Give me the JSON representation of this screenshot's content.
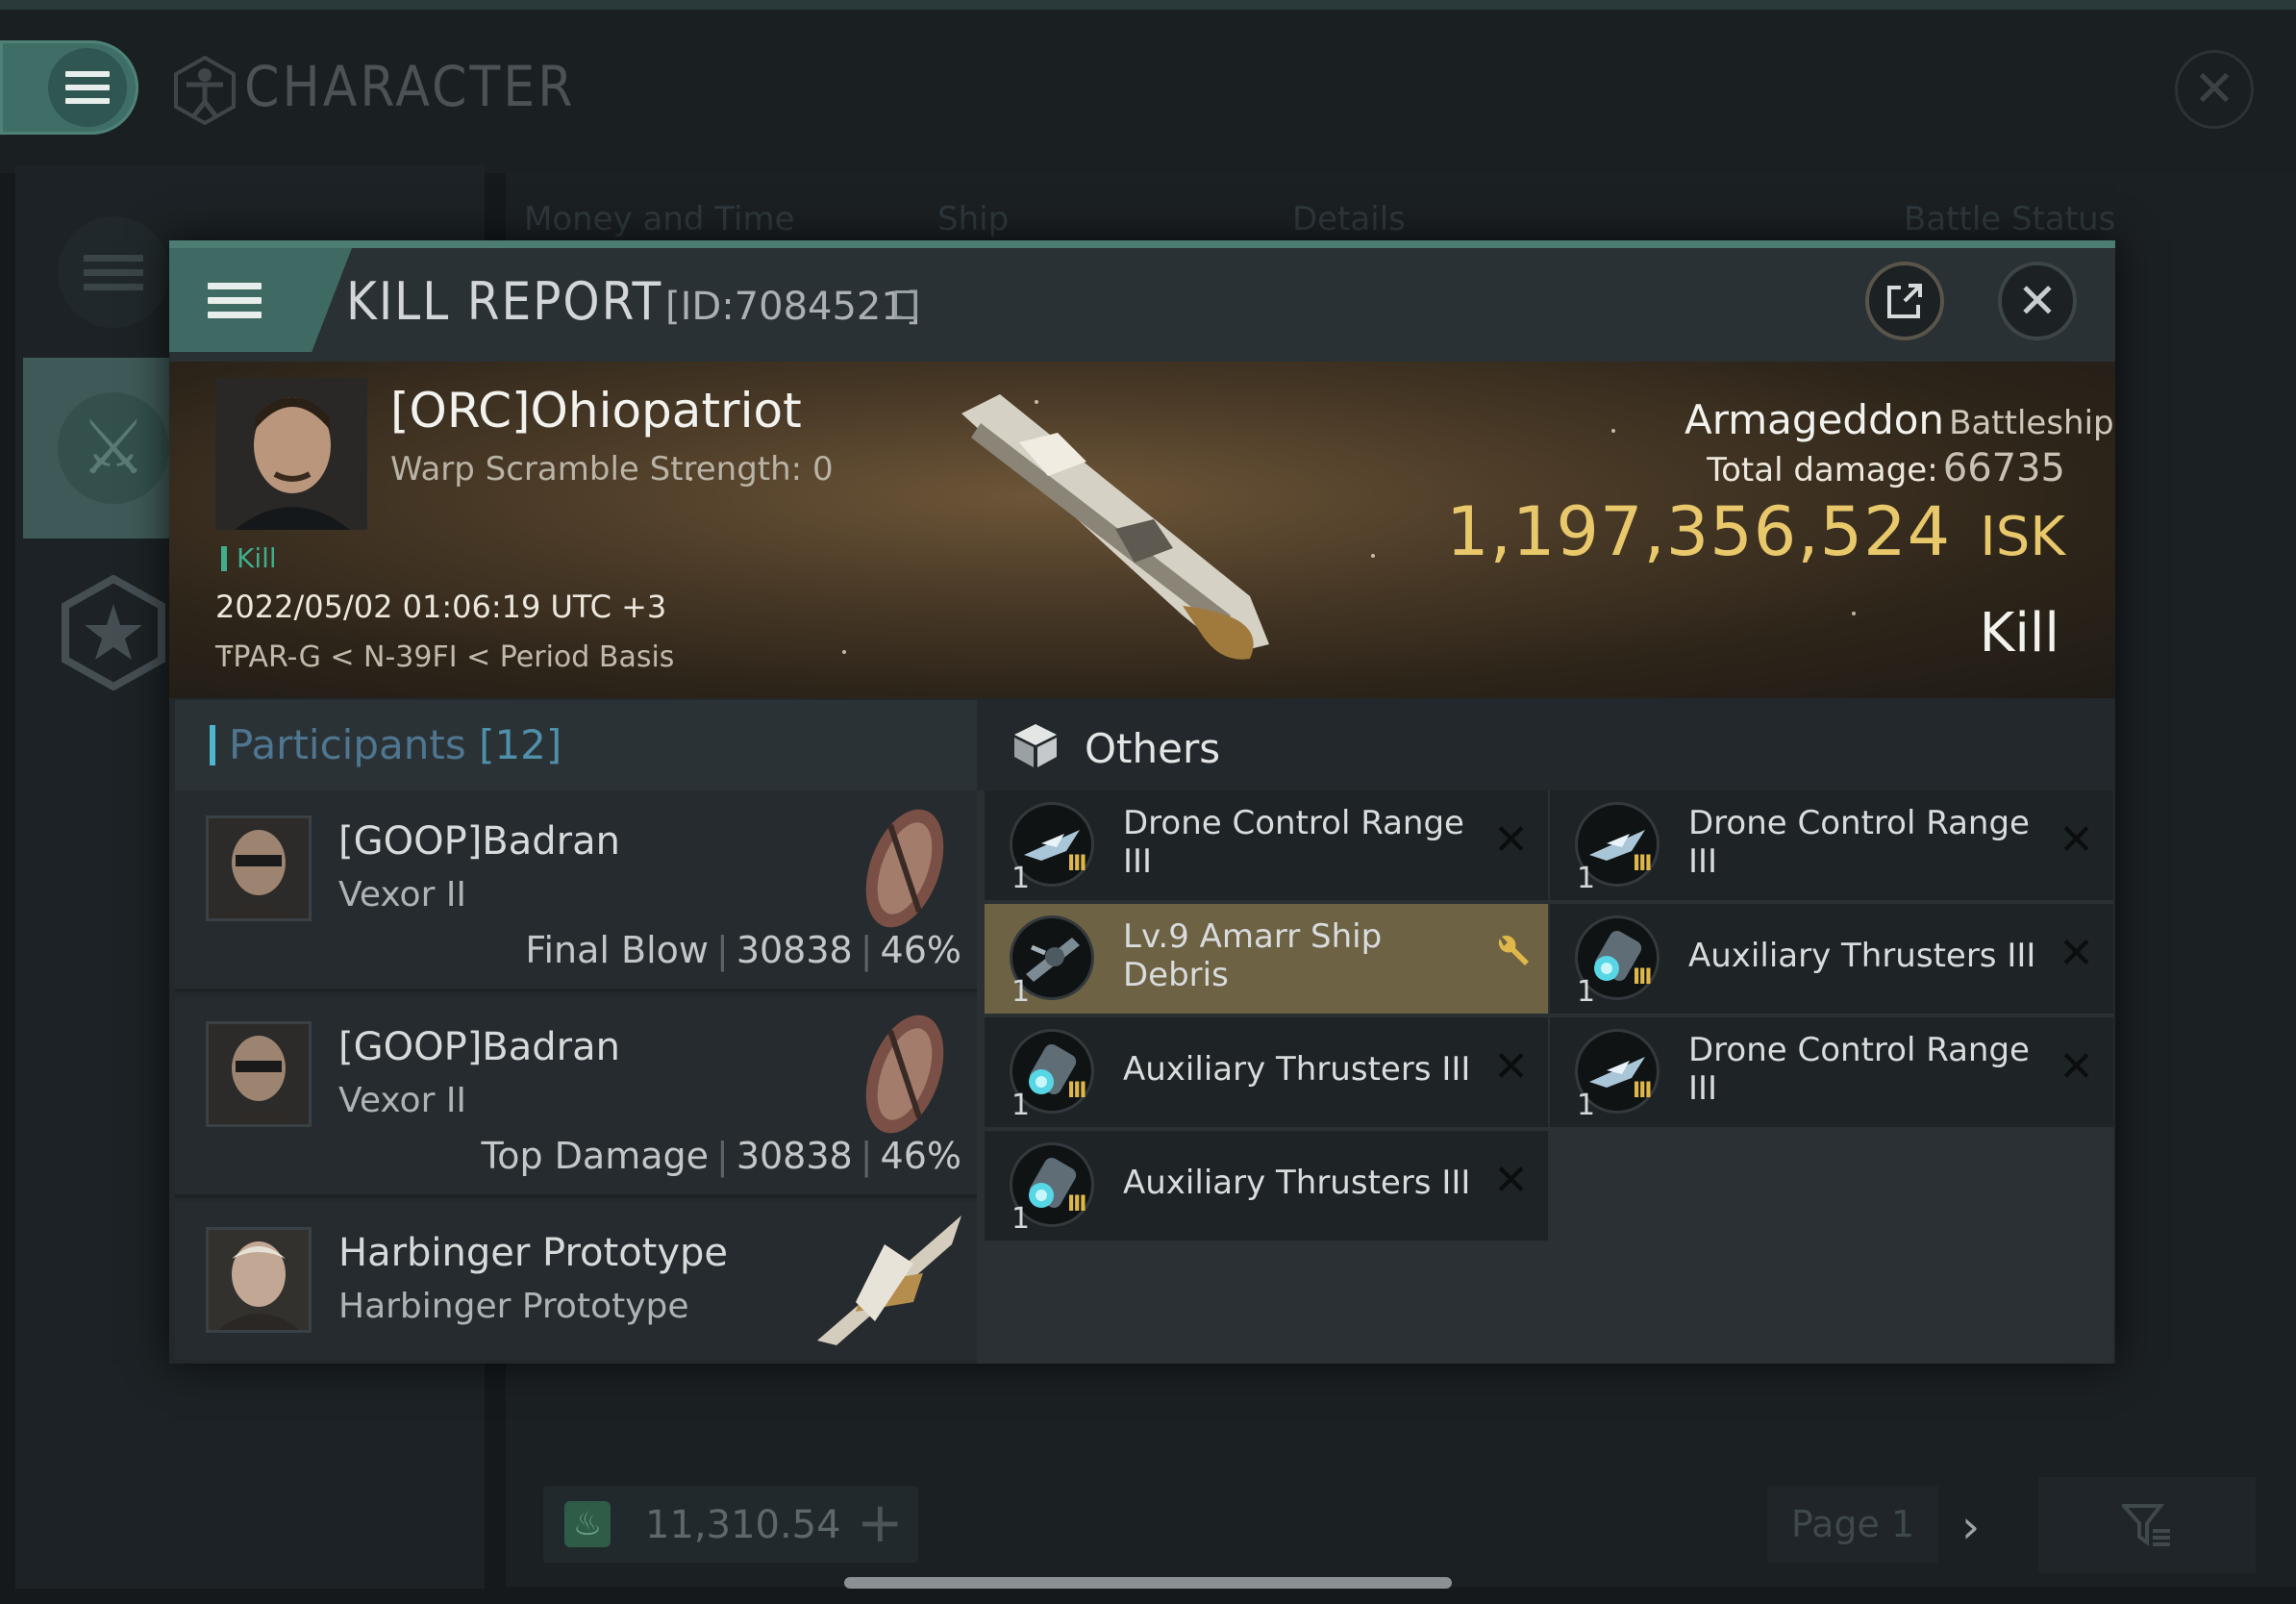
{
  "background": {
    "title": "CHARACTER",
    "columns": [
      "Money and Time",
      "Ship",
      "Details",
      "Battle Status"
    ],
    "wallet_value": "11,310.54",
    "page_label": "Page 1"
  },
  "kill_report": {
    "title": "KILL REPORT",
    "id_text": "[ID:7084521]",
    "victim": {
      "name": "[ORC]Ohiopatriot",
      "warp_scramble": "Warp Scramble Strength: 0",
      "kill_tag": "Kill",
      "datetime": "2022/05/02 01:06:19 UTC +3",
      "location": "TPAR-G < N-39FI < Period Basis"
    },
    "ship": {
      "name": "Armageddon",
      "class": "Battleship",
      "total_damage_label": "Total damage:",
      "total_damage": "66735",
      "isk_value": "1,197,356,524",
      "isk_unit": "ISK",
      "status": "Kill"
    },
    "participants": {
      "label": "Participants",
      "count": "[12]",
      "rows": [
        {
          "name": "[GOOP]Badran",
          "ship": "Vexor II",
          "role": "Final Blow",
          "damage": "30838",
          "percent": "46%"
        },
        {
          "name": "[GOOP]Badran",
          "ship": "Vexor II",
          "role": "Top Damage",
          "damage": "30838",
          "percent": "46%"
        },
        {
          "name": "Harbinger Prototype",
          "ship": "Harbinger Prototype",
          "role": "",
          "damage": "",
          "percent": ""
        }
      ]
    },
    "others": {
      "label": "Others",
      "items": [
        {
          "qty": "1",
          "name": "Drone Control Range III",
          "tier": "III",
          "icon": "drone-control-icon",
          "highlight": false
        },
        {
          "qty": "1",
          "name": "Drone Control Range III",
          "tier": "III",
          "icon": "drone-control-icon",
          "highlight": false
        },
        {
          "qty": "1",
          "name": "Lv.9 Amarr Ship Debris",
          "tier": "",
          "icon": "ship-debris-icon",
          "highlight": true
        },
        {
          "qty": "1",
          "name": "Auxiliary Thrusters III",
          "tier": "III",
          "icon": "thruster-icon",
          "highlight": false
        },
        {
          "qty": "1",
          "name": "Auxiliary Thrusters III",
          "tier": "III",
          "icon": "thruster-icon",
          "highlight": false
        },
        {
          "qty": "1",
          "name": "Drone Control Range III",
          "tier": "III",
          "icon": "drone-control-icon",
          "highlight": false
        },
        {
          "qty": "1",
          "name": "Auxiliary Thrusters III",
          "tier": "III",
          "icon": "thruster-icon",
          "highlight": false
        }
      ]
    }
  },
  "colors": {
    "accent_teal": "#3e6a63",
    "isk_gold": "#e8c86a",
    "kill_green": "#3fae8c",
    "participants_blue": "#4f90aa",
    "debris_highlight": "#6e6245"
  }
}
